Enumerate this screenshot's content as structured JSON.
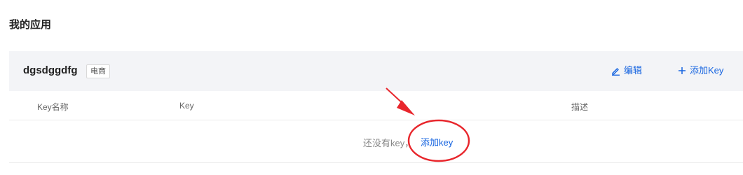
{
  "page": {
    "title": "我的应用"
  },
  "app": {
    "name": "dgsdggdfg",
    "category": "电商",
    "edit_label": "编辑",
    "add_key_label": "添加Key"
  },
  "table": {
    "columns": [
      "Key名称",
      "Key",
      "描述"
    ],
    "empty_text": "还没有key，",
    "empty_link": "添加key"
  },
  "icons": {
    "edit": "pencil-icon",
    "add": "plus-icon"
  },
  "colors": {
    "link": "#1664e0",
    "header_bg": "#f3f4f7",
    "annotation": "#e8262c"
  }
}
